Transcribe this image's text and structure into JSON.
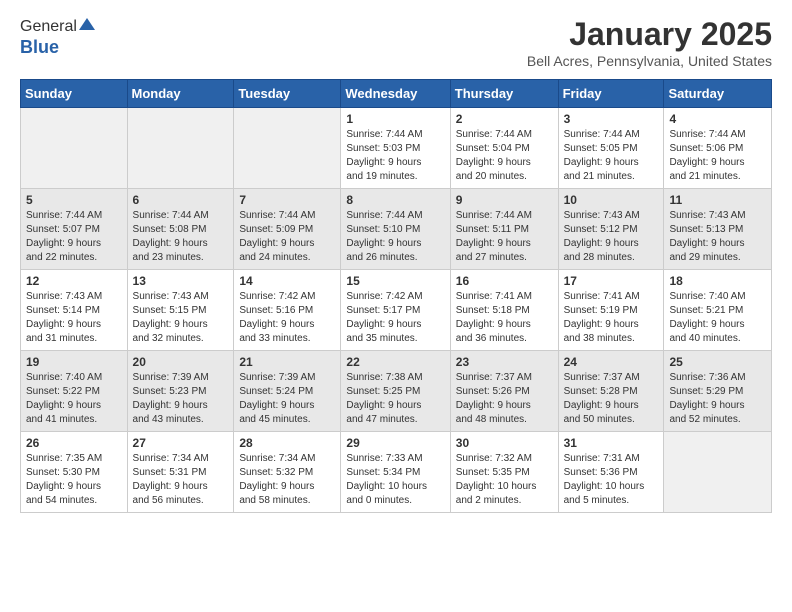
{
  "header": {
    "logo": {
      "general": "General",
      "blue": "Blue"
    },
    "title": "January 2025",
    "subtitle": "Bell Acres, Pennsylvania, United States"
  },
  "calendar": {
    "days_of_week": [
      "Sunday",
      "Monday",
      "Tuesday",
      "Wednesday",
      "Thursday",
      "Friday",
      "Saturday"
    ],
    "weeks": [
      [
        {
          "day": "",
          "info": ""
        },
        {
          "day": "",
          "info": ""
        },
        {
          "day": "",
          "info": ""
        },
        {
          "day": "1",
          "info": "Sunrise: 7:44 AM\nSunset: 5:03 PM\nDaylight: 9 hours\nand 19 minutes."
        },
        {
          "day": "2",
          "info": "Sunrise: 7:44 AM\nSunset: 5:04 PM\nDaylight: 9 hours\nand 20 minutes."
        },
        {
          "day": "3",
          "info": "Sunrise: 7:44 AM\nSunset: 5:05 PM\nDaylight: 9 hours\nand 21 minutes."
        },
        {
          "day": "4",
          "info": "Sunrise: 7:44 AM\nSunset: 5:06 PM\nDaylight: 9 hours\nand 21 minutes."
        }
      ],
      [
        {
          "day": "5",
          "info": "Sunrise: 7:44 AM\nSunset: 5:07 PM\nDaylight: 9 hours\nand 22 minutes."
        },
        {
          "day": "6",
          "info": "Sunrise: 7:44 AM\nSunset: 5:08 PM\nDaylight: 9 hours\nand 23 minutes."
        },
        {
          "day": "7",
          "info": "Sunrise: 7:44 AM\nSunset: 5:09 PM\nDaylight: 9 hours\nand 24 minutes."
        },
        {
          "day": "8",
          "info": "Sunrise: 7:44 AM\nSunset: 5:10 PM\nDaylight: 9 hours\nand 26 minutes."
        },
        {
          "day": "9",
          "info": "Sunrise: 7:44 AM\nSunset: 5:11 PM\nDaylight: 9 hours\nand 27 minutes."
        },
        {
          "day": "10",
          "info": "Sunrise: 7:43 AM\nSunset: 5:12 PM\nDaylight: 9 hours\nand 28 minutes."
        },
        {
          "day": "11",
          "info": "Sunrise: 7:43 AM\nSunset: 5:13 PM\nDaylight: 9 hours\nand 29 minutes."
        }
      ],
      [
        {
          "day": "12",
          "info": "Sunrise: 7:43 AM\nSunset: 5:14 PM\nDaylight: 9 hours\nand 31 minutes."
        },
        {
          "day": "13",
          "info": "Sunrise: 7:43 AM\nSunset: 5:15 PM\nDaylight: 9 hours\nand 32 minutes."
        },
        {
          "day": "14",
          "info": "Sunrise: 7:42 AM\nSunset: 5:16 PM\nDaylight: 9 hours\nand 33 minutes."
        },
        {
          "day": "15",
          "info": "Sunrise: 7:42 AM\nSunset: 5:17 PM\nDaylight: 9 hours\nand 35 minutes."
        },
        {
          "day": "16",
          "info": "Sunrise: 7:41 AM\nSunset: 5:18 PM\nDaylight: 9 hours\nand 36 minutes."
        },
        {
          "day": "17",
          "info": "Sunrise: 7:41 AM\nSunset: 5:19 PM\nDaylight: 9 hours\nand 38 minutes."
        },
        {
          "day": "18",
          "info": "Sunrise: 7:40 AM\nSunset: 5:21 PM\nDaylight: 9 hours\nand 40 minutes."
        }
      ],
      [
        {
          "day": "19",
          "info": "Sunrise: 7:40 AM\nSunset: 5:22 PM\nDaylight: 9 hours\nand 41 minutes."
        },
        {
          "day": "20",
          "info": "Sunrise: 7:39 AM\nSunset: 5:23 PM\nDaylight: 9 hours\nand 43 minutes."
        },
        {
          "day": "21",
          "info": "Sunrise: 7:39 AM\nSunset: 5:24 PM\nDaylight: 9 hours\nand 45 minutes."
        },
        {
          "day": "22",
          "info": "Sunrise: 7:38 AM\nSunset: 5:25 PM\nDaylight: 9 hours\nand 47 minutes."
        },
        {
          "day": "23",
          "info": "Sunrise: 7:37 AM\nSunset: 5:26 PM\nDaylight: 9 hours\nand 48 minutes."
        },
        {
          "day": "24",
          "info": "Sunrise: 7:37 AM\nSunset: 5:28 PM\nDaylight: 9 hours\nand 50 minutes."
        },
        {
          "day": "25",
          "info": "Sunrise: 7:36 AM\nSunset: 5:29 PM\nDaylight: 9 hours\nand 52 minutes."
        }
      ],
      [
        {
          "day": "26",
          "info": "Sunrise: 7:35 AM\nSunset: 5:30 PM\nDaylight: 9 hours\nand 54 minutes."
        },
        {
          "day": "27",
          "info": "Sunrise: 7:34 AM\nSunset: 5:31 PM\nDaylight: 9 hours\nand 56 minutes."
        },
        {
          "day": "28",
          "info": "Sunrise: 7:34 AM\nSunset: 5:32 PM\nDaylight: 9 hours\nand 58 minutes."
        },
        {
          "day": "29",
          "info": "Sunrise: 7:33 AM\nSunset: 5:34 PM\nDaylight: 10 hours\nand 0 minutes."
        },
        {
          "day": "30",
          "info": "Sunrise: 7:32 AM\nSunset: 5:35 PM\nDaylight: 10 hours\nand 2 minutes."
        },
        {
          "day": "31",
          "info": "Sunrise: 7:31 AM\nSunset: 5:36 PM\nDaylight: 10 hours\nand 5 minutes."
        },
        {
          "day": "",
          "info": ""
        }
      ]
    ]
  }
}
